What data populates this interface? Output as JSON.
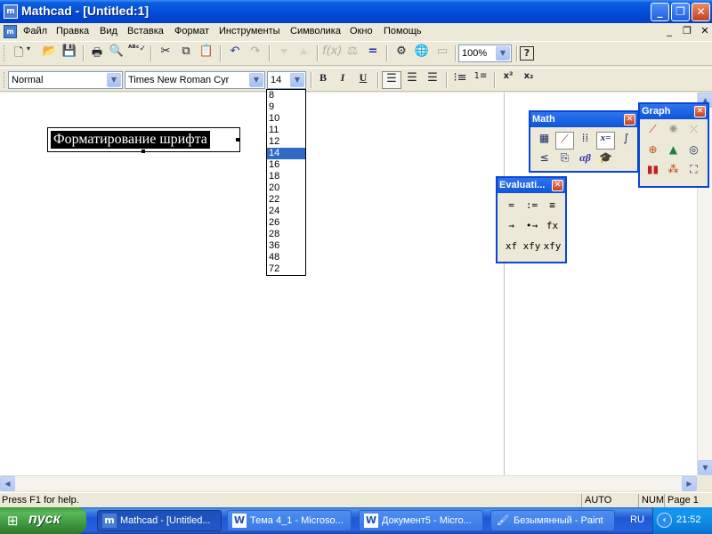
{
  "window": {
    "title": "Mathcad - [Untitled:1]",
    "app_icon": "m",
    "minimize_glyph": "_",
    "restore_glyph": "❐",
    "close_glyph": "✕"
  },
  "menu": {
    "items": [
      "Файл",
      "Правка",
      "Вид",
      "Вставка",
      "Формат",
      "Инструменты",
      "Символика",
      "Окно",
      "Помощь"
    ],
    "mdi_minimize": "_",
    "mdi_restore": "❐",
    "mdi_close": "✕"
  },
  "toolbar": {
    "zoom_value": "100%",
    "help_glyph": "?",
    "icons": [
      "new-icon",
      "open-icon",
      "save-icon",
      "print-icon",
      "print-preview-icon",
      "spell-check-icon",
      "cut-icon",
      "copy-icon",
      "paste-icon",
      "undo-icon",
      "redo-icon",
      "align-top-icon",
      "align-bottom-icon",
      "insert-function-icon",
      "insert-unit-icon",
      "calculate-icon",
      "insert-component-icon",
      "resource-center-icon",
      "hyperlink-icon"
    ]
  },
  "format_bar": {
    "style_value": "Normal",
    "font_value": "Times New Roman Cyr",
    "size_value": "14",
    "bold": "B",
    "italic": "I",
    "underline": "U",
    "superscript": "x²",
    "subscript": "x₂"
  },
  "font_sizes": [
    "8",
    "9",
    "10",
    "11",
    "12",
    "14",
    "16",
    "18",
    "20",
    "22",
    "24",
    "26",
    "28",
    "36",
    "48",
    "72"
  ],
  "font_size_selected": "14",
  "document": {
    "text_region": "Форматирование шрифта"
  },
  "palettes": {
    "math": {
      "title": "Math",
      "icons": [
        "calculator-icon",
        "graph-icon",
        "matrix-icon",
        "evaluation-icon",
        "calculus-icon",
        "boolean-icon",
        "programming-icon",
        "greek-icon",
        "symbolic-icon"
      ],
      "greek_label": "αβ",
      "eval_label": "x="
    },
    "graph": {
      "title": "Graph",
      "icons": [
        "xy-plot-icon",
        "polar-plot-icon",
        "surface-plot-icon",
        "contour-plot-icon",
        "3d-scatter-icon",
        "3d-bar-icon",
        "vector-field-icon",
        "zoom-icon",
        "trace-icon"
      ]
    },
    "evaluation": {
      "title": "Evaluati...",
      "buttons": [
        "=",
        ":=",
        "≡",
        "→",
        "•→",
        "fx",
        "xf",
        "xfy",
        "xfy"
      ]
    }
  },
  "status": {
    "help": "Press F1 for help.",
    "mode": "AUTO",
    "num": "NUM",
    "page": "Page 1"
  },
  "taskbar": {
    "start": "пуск",
    "tasks": [
      {
        "label": "Mathcad - [Untitled...",
        "icon": "mathcad-icon"
      },
      {
        "label": "Тема 4_1 - Microso...",
        "icon": "word-icon"
      },
      {
        "label": "Документ5 - Micro...",
        "icon": "word-icon"
      },
      {
        "label": "Безымянный - Paint",
        "icon": "paint-icon"
      }
    ],
    "language": "RU",
    "clock": "21:52"
  }
}
